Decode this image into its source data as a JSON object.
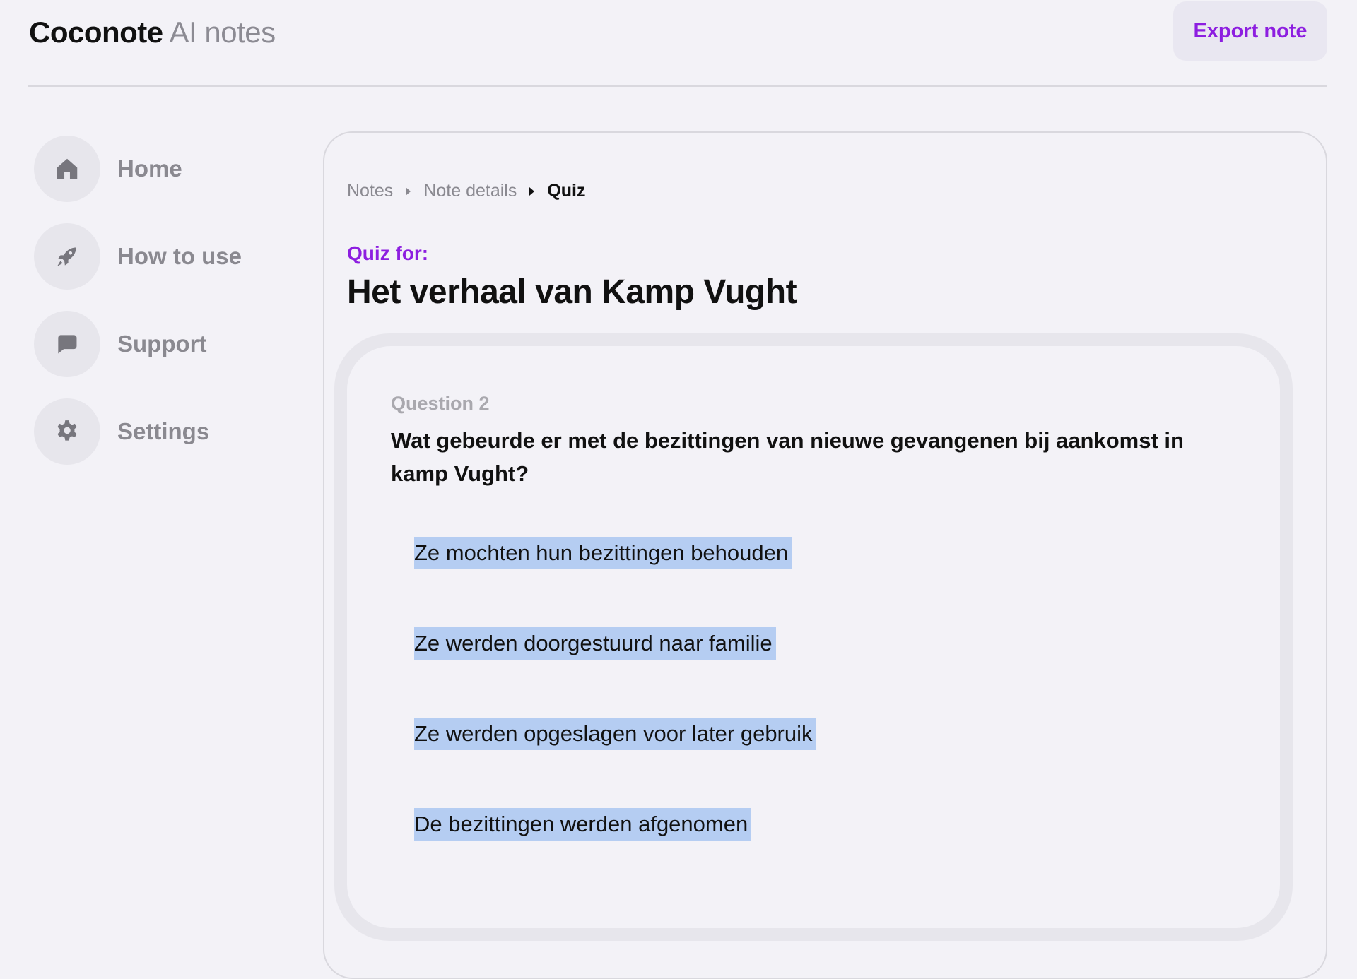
{
  "header": {
    "brand_name": "Coconote",
    "brand_sub": "AI notes",
    "export_label": "Export note"
  },
  "sidebar": {
    "items": [
      {
        "label": "Home",
        "icon": "home-icon"
      },
      {
        "label": "How to use",
        "icon": "rocket-icon"
      },
      {
        "label": "Support",
        "icon": "chat-icon"
      },
      {
        "label": "Settings",
        "icon": "gear-icon"
      }
    ]
  },
  "breadcrumb": {
    "items": [
      "Notes",
      "Note details",
      "Quiz"
    ]
  },
  "quiz": {
    "label": "Quiz for:",
    "title": "Het verhaal van Kamp Vught",
    "question_number": "Question 2",
    "question_text": "Wat gebeurde er met de bezittingen van nieuwe gevangenen bij aankomst in kamp Vught?",
    "answers": [
      "Ze mochten hun bezittingen behouden",
      "Ze werden doorgestuurd naar familie",
      "Ze werden opgeslagen voor later gebruik",
      "De bezittingen werden afgenomen"
    ]
  },
  "colors": {
    "accent": "#8d1ee0",
    "selection": "#b5cdf2",
    "background": "#f3f2f7"
  }
}
